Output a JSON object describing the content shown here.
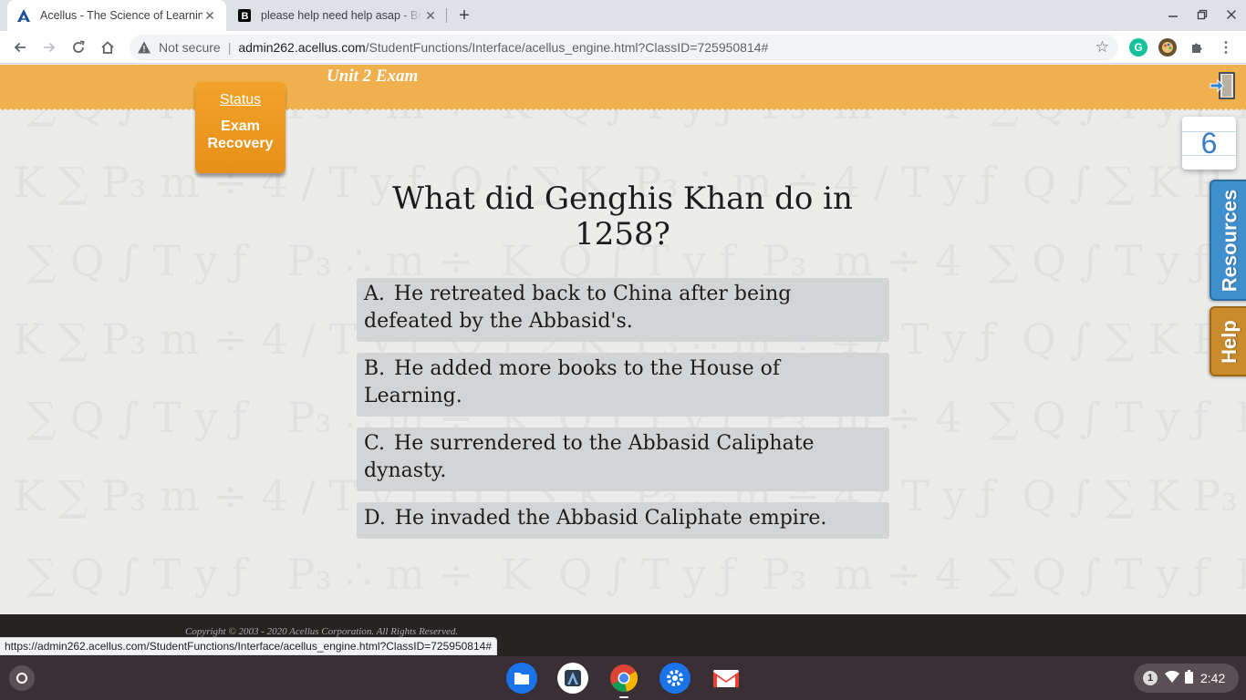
{
  "browser": {
    "tabs": [
      {
        "title": "Acellus - The Science of Learning",
        "favicon": "acellus-logo-icon",
        "active": true
      },
      {
        "title": "please help need help asap - Brainly",
        "favicon": "brainly-logo-icon",
        "active": false
      }
    ],
    "address": {
      "security_label": "Not secure",
      "host": "admin262.acellus.com",
      "path": "/StudentFunctions/Interface/acellus_engine.html?ClassID=725950814#"
    },
    "status_url": "https://admin262.acellus.com/StudentFunctions/Interface/acellus_engine.html?ClassID=725950814#"
  },
  "lesson": {
    "unit_title": "Unit 2 Exam",
    "status": {
      "label": "Status",
      "value": "Exam Recovery"
    },
    "question_number": "6",
    "side_tabs": {
      "resources": "Resources",
      "help": "Help"
    },
    "question": "What did Genghis Khan do in 1258?",
    "choices": [
      {
        "letter": "A.",
        "text": "He retreated back to China after being defeated by the Abbasid's."
      },
      {
        "letter": "B.",
        "text": "He added more books to the House of Learning."
      },
      {
        "letter": "C.",
        "text": "He surrendered to the Abbasid Caliphate dynasty."
      },
      {
        "letter": "D.",
        "text": "He invaded the Abbasid Caliphate empire."
      }
    ],
    "copyright": "Copyright © 2003 - 2020 Acellus Corporation.  All Rights Reserved."
  },
  "shelf": {
    "apps": [
      "files-icon",
      "acellus-app-icon",
      "chrome-icon",
      "settings-icon",
      "gmail-icon"
    ],
    "notification_count": "1",
    "time": "2:42"
  },
  "colors": {
    "banner": "#f0b04e",
    "status_badge": "#f2a32a",
    "resources_tab": "#3f8fcc",
    "help_tab": "#c98b2b",
    "choice_bg": "#d3d4d6",
    "counter_text": "#3b7dc4"
  }
}
